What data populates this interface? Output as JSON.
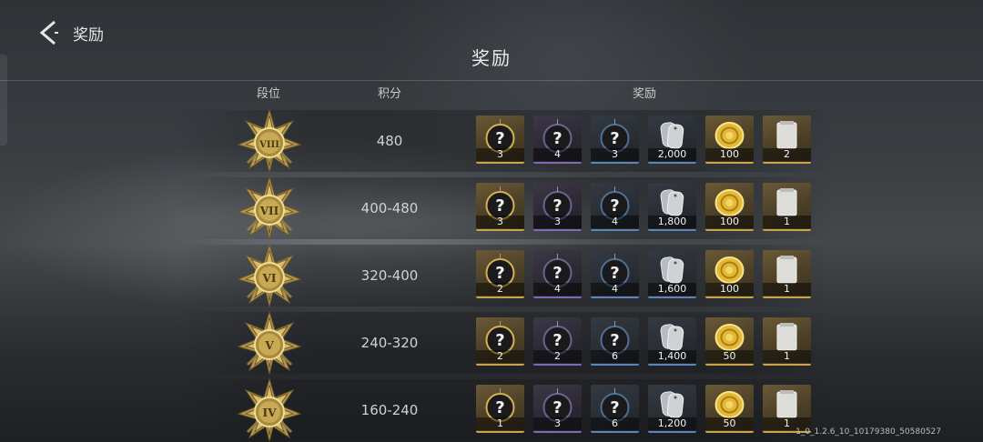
{
  "header": {
    "back_label": "奖励",
    "title": "奖励"
  },
  "columns": {
    "rank": "段位",
    "score": "积分",
    "reward": "奖励"
  },
  "rows": [
    {
      "rank_numeral": "VIII",
      "score": "480",
      "rewards": [
        {
          "kind": "mystery-gold",
          "qty": "3"
        },
        {
          "kind": "mystery-purple",
          "qty": "4"
        },
        {
          "kind": "mystery-blue",
          "qty": "3"
        },
        {
          "kind": "dog-tags",
          "qty": "2,000"
        },
        {
          "kind": "gold-coin",
          "qty": "100"
        },
        {
          "kind": "card",
          "qty": "2"
        }
      ]
    },
    {
      "rank_numeral": "VII",
      "score": "400-480",
      "rewards": [
        {
          "kind": "mystery-gold",
          "qty": "3"
        },
        {
          "kind": "mystery-purple",
          "qty": "3"
        },
        {
          "kind": "mystery-blue",
          "qty": "4"
        },
        {
          "kind": "dog-tags",
          "qty": "1,800"
        },
        {
          "kind": "gold-coin",
          "qty": "100"
        },
        {
          "kind": "card",
          "qty": "1"
        }
      ]
    },
    {
      "rank_numeral": "VI",
      "score": "320-400",
      "rewards": [
        {
          "kind": "mystery-gold",
          "qty": "2"
        },
        {
          "kind": "mystery-purple",
          "qty": "4"
        },
        {
          "kind": "mystery-blue",
          "qty": "4"
        },
        {
          "kind": "dog-tags",
          "qty": "1,600"
        },
        {
          "kind": "gold-coin",
          "qty": "100"
        },
        {
          "kind": "card",
          "qty": "1"
        }
      ]
    },
    {
      "rank_numeral": "V",
      "score": "240-320",
      "rewards": [
        {
          "kind": "mystery-gold",
          "qty": "2"
        },
        {
          "kind": "mystery-purple",
          "qty": "2"
        },
        {
          "kind": "mystery-blue",
          "qty": "6"
        },
        {
          "kind": "dog-tags",
          "qty": "1,400"
        },
        {
          "kind": "gold-coin",
          "qty": "50"
        },
        {
          "kind": "card",
          "qty": "1"
        }
      ]
    },
    {
      "rank_numeral": "IV",
      "score": "160-240",
      "rewards": [
        {
          "kind": "mystery-gold",
          "qty": "1"
        },
        {
          "kind": "mystery-purple",
          "qty": "3"
        },
        {
          "kind": "mystery-blue",
          "qty": "6"
        },
        {
          "kind": "dog-tags",
          "qty": "1,200"
        },
        {
          "kind": "gold-coin",
          "qty": "50"
        },
        {
          "kind": "card",
          "qty": "1"
        }
      ]
    }
  ],
  "version": "1_0_1.2.6_10_10179380_50580527",
  "colors": {
    "gold_accent": "#c9a44a",
    "purple_accent": "#7f6ab8",
    "blue_accent": "#5d86b8",
    "gray_accent": "#8f9296"
  }
}
